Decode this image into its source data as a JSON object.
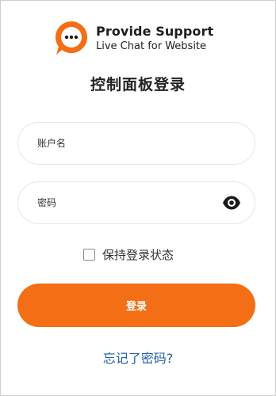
{
  "logo": {
    "name": "Provide Support",
    "tagline": "Live Chat for Website"
  },
  "page_title": "控制面板登录",
  "form": {
    "username_placeholder": "账户名",
    "password_placeholder": "密码",
    "show_password_icon": "eye-icon",
    "remember_label": "保持登录状态",
    "remember_checked": false,
    "login_label": "登录",
    "forgot_link": "忘记了密码?"
  },
  "colors": {
    "brand_orange": "#f36e14",
    "link_blue": "#1f5fa8",
    "text_dark": "#222222"
  }
}
